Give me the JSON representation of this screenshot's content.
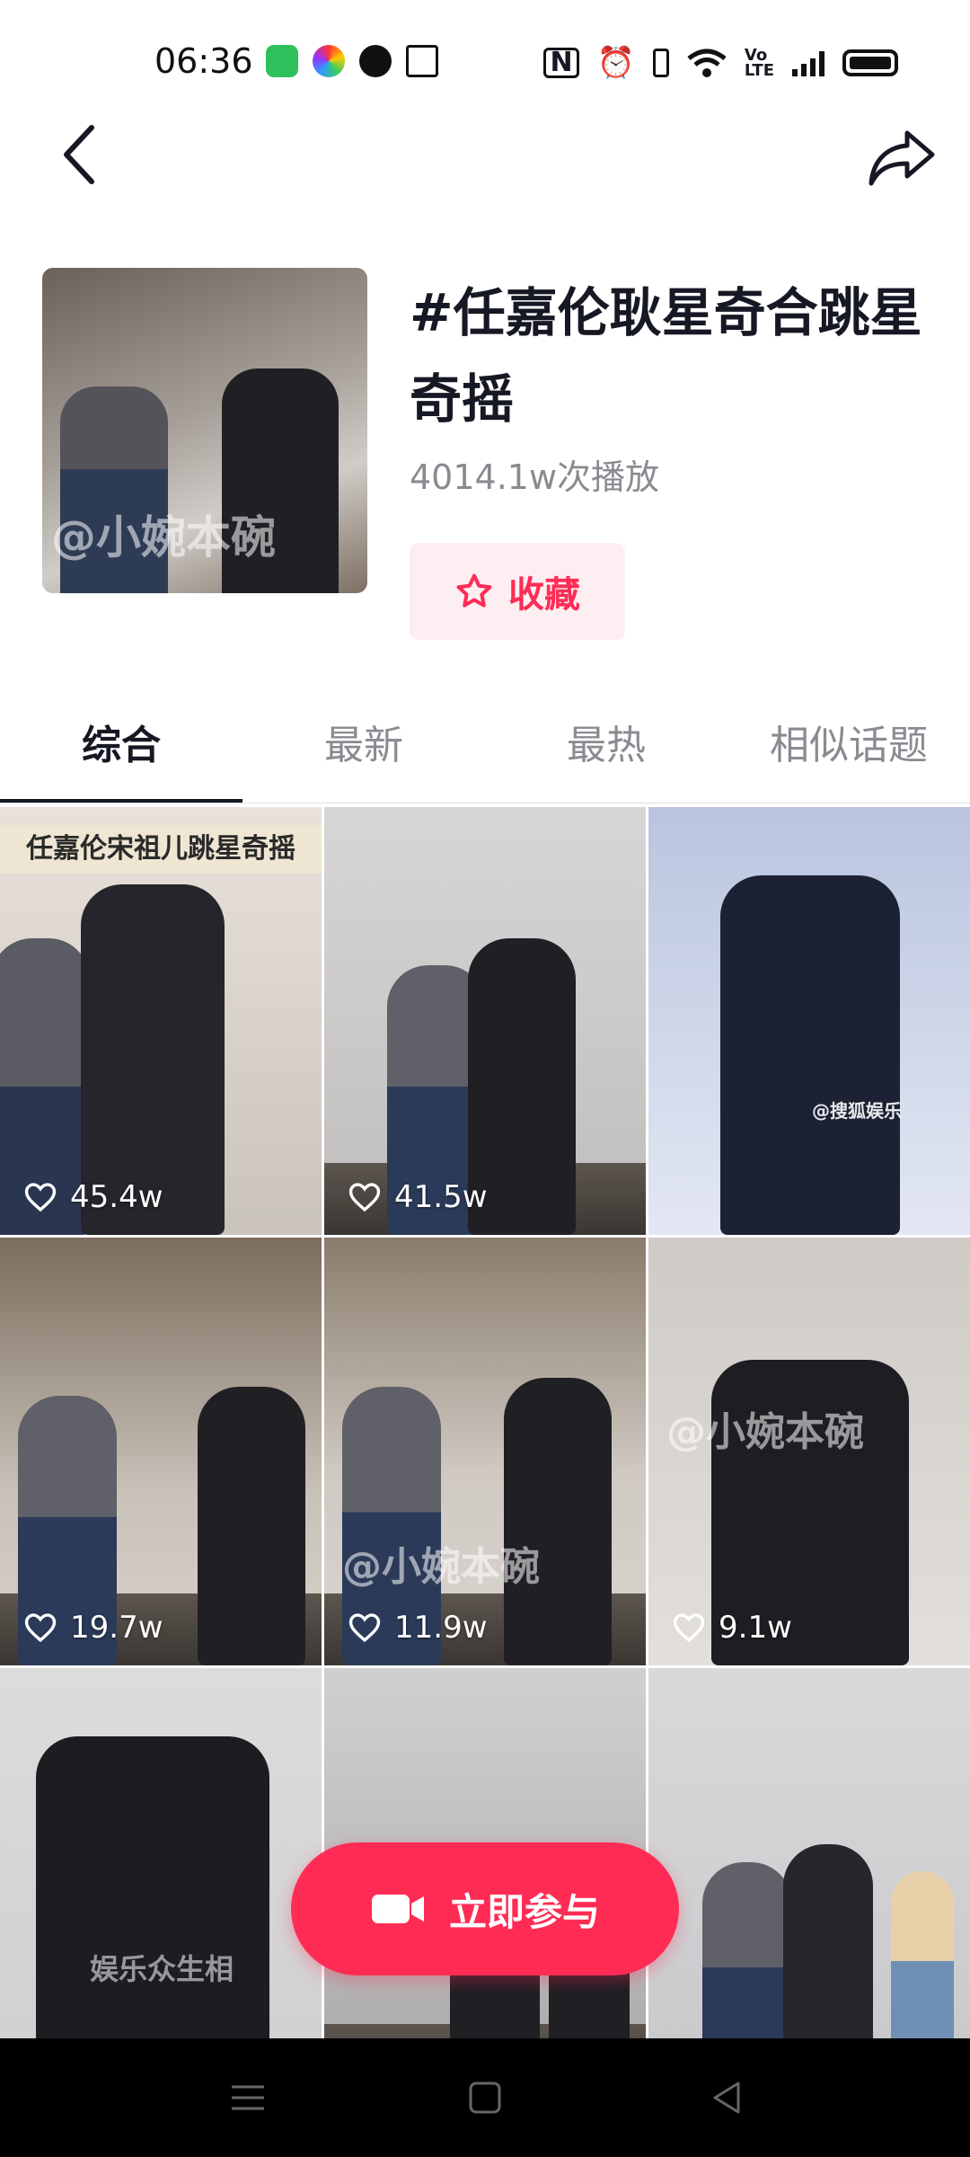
{
  "status_bar": {
    "time": "06:36",
    "left_icons": [
      "app-icon-green",
      "app-icon-colorful",
      "shazam-icon",
      "news-icon"
    ],
    "right_icons": [
      "nfc-icon",
      "alarm-icon",
      "vibrate-icon",
      "wifi-icon",
      "volte-icon",
      "signal-icon",
      "battery-icon"
    ]
  },
  "nav": {
    "back_icon": "chevron-left-icon",
    "share_icon": "share-arrow-icon"
  },
  "topic": {
    "title": "#任嘉伦耿星奇合跳星奇摇",
    "plays": "4014.1w次播放",
    "favorite_label": "收藏",
    "cover_watermark": "@小婉本碗"
  },
  "tabs": [
    {
      "label": "综合",
      "active": true
    },
    {
      "label": "最新",
      "active": false
    },
    {
      "label": "最热",
      "active": false
    },
    {
      "label": "相似话题",
      "active": false
    }
  ],
  "videos": [
    {
      "likes": "45.4w",
      "caption": "任嘉伦宋祖儿跳星奇摇",
      "watermark": ""
    },
    {
      "likes": "41.5w",
      "caption": "",
      "watermark": ""
    },
    {
      "likes": "",
      "caption": "",
      "watermark": "@搜狐娱乐"
    },
    {
      "likes": "19.7w",
      "caption": "",
      "watermark": ""
    },
    {
      "likes": "11.9w",
      "caption": "",
      "watermark": "@小婉本碗"
    },
    {
      "likes": "9.1w",
      "caption": "",
      "watermark": "@小婉本碗"
    },
    {
      "likes": "",
      "caption": "",
      "watermark": "娱乐众生相"
    },
    {
      "likes": "",
      "caption": "",
      "watermark": ""
    },
    {
      "likes": "",
      "caption": "",
      "watermark": ""
    }
  ],
  "join_button": {
    "label": "立即参与",
    "icon": "video-camera-icon"
  },
  "system_nav": [
    "menu-icon",
    "home-icon",
    "back-triangle-icon"
  ],
  "colors": {
    "accent": "#fe2c55",
    "text": "#161823",
    "muted": "#8a8b91"
  }
}
